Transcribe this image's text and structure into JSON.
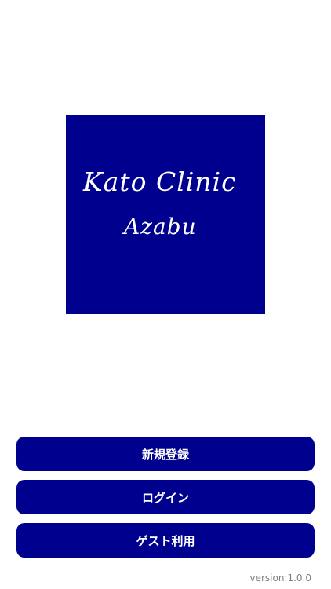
{
  "logo": {
    "line1": "Kato Clinic",
    "line2": "Azabu",
    "background_color": "#00008f",
    "text_color": "#ffffff"
  },
  "buttons": {
    "register_label": "新規登録",
    "login_label": "ログイン",
    "guest_label": "ゲスト利用"
  },
  "theme": {
    "accent": "#00008f"
  },
  "footer": {
    "version": "version:1.0.0"
  }
}
